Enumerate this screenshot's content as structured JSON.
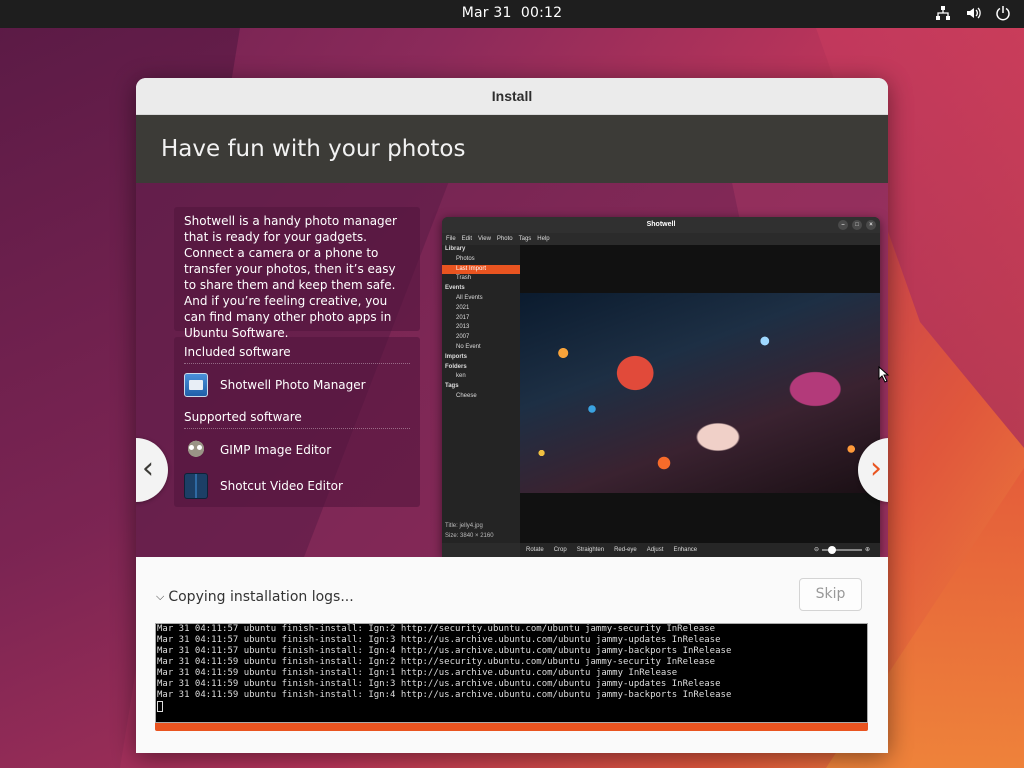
{
  "topbar": {
    "date": "Mar 31",
    "time": "00:12",
    "tray_icons": [
      "network-icon",
      "volume-icon",
      "power-icon"
    ]
  },
  "window": {
    "title": "Install"
  },
  "slide": {
    "header": "Have fun with your photos",
    "description": "Shotwell is a handy photo manager that is ready for your gadgets. Connect a camera or a phone to transfer your photos, then it’s easy to share them and keep them safe. And if you’re feeling creative, you can find many other photo apps in Ubuntu Software.",
    "included_heading": "Included software",
    "included": [
      {
        "label": "Shotwell Photo Manager",
        "icon": "shotwell-icon"
      }
    ],
    "supported_heading": "Supported software",
    "supported": [
      {
        "label": "GIMP Image Editor",
        "icon": "gimp-icon"
      },
      {
        "label": "Shotcut Video Editor",
        "icon": "shotcut-icon"
      }
    ],
    "prev_glyph": "‹",
    "next_glyph": "›"
  },
  "preview": {
    "title": "Shotwell",
    "menu": [
      "File",
      "Edit",
      "View",
      "Photo",
      "Tags",
      "Help"
    ],
    "sidebar": [
      {
        "label": "Library",
        "type": "sec"
      },
      {
        "label": "Photos",
        "type": "item"
      },
      {
        "label": "Last Import",
        "type": "item",
        "selected": true
      },
      {
        "label": "Trash",
        "type": "item"
      },
      {
        "label": "Events",
        "type": "sec"
      },
      {
        "label": "All Events",
        "type": "item"
      },
      {
        "label": "2021",
        "type": "item"
      },
      {
        "label": "2017",
        "type": "item"
      },
      {
        "label": "2013",
        "type": "item"
      },
      {
        "label": "2007",
        "type": "item"
      },
      {
        "label": "No Event",
        "type": "item"
      },
      {
        "label": "Imports",
        "type": "sec"
      },
      {
        "label": "Folders",
        "type": "sec"
      },
      {
        "label": "ken",
        "type": "item"
      },
      {
        "label": "Tags",
        "type": "sec"
      },
      {
        "label": "Cheese",
        "type": "item"
      }
    ],
    "meta_title_label": "Title:",
    "meta_title": "jelly4.jpg",
    "meta_size_label": "Size:",
    "meta_size": "3840 × 2160",
    "tools": [
      "Rotate",
      "Crop",
      "Straighten",
      "Red-eye",
      "Adjust",
      "Enhance"
    ]
  },
  "install": {
    "status": "Copying installation logs...",
    "skip_label": "Skip",
    "progress": 1.0,
    "log_lines": [
      "Mar 31 04:11:57 ubuntu finish-install: Ign:2 http://security.ubuntu.com/ubuntu jammy-security InRelease",
      "Mar 31 04:11:57 ubuntu finish-install: Ign:3 http://us.archive.ubuntu.com/ubuntu jammy-updates InRelease",
      "Mar 31 04:11:57 ubuntu finish-install: Ign:4 http://us.archive.ubuntu.com/ubuntu jammy-backports InRelease",
      "Mar 31 04:11:59 ubuntu finish-install: Ign:2 http://security.ubuntu.com/ubuntu jammy-security InRelease",
      "Mar 31 04:11:59 ubuntu finish-install: Ign:1 http://us.archive.ubuntu.com/ubuntu jammy InRelease",
      "Mar 31 04:11:59 ubuntu finish-install: Ign:3 http://us.archive.ubuntu.com/ubuntu jammy-updates InRelease",
      "Mar 31 04:11:59 ubuntu finish-install: Ign:4 http://us.archive.ubuntu.com/ubuntu jammy-backports InRelease"
    ]
  },
  "colors": {
    "accent": "#e95420",
    "header_bg": "#3c3b37"
  }
}
